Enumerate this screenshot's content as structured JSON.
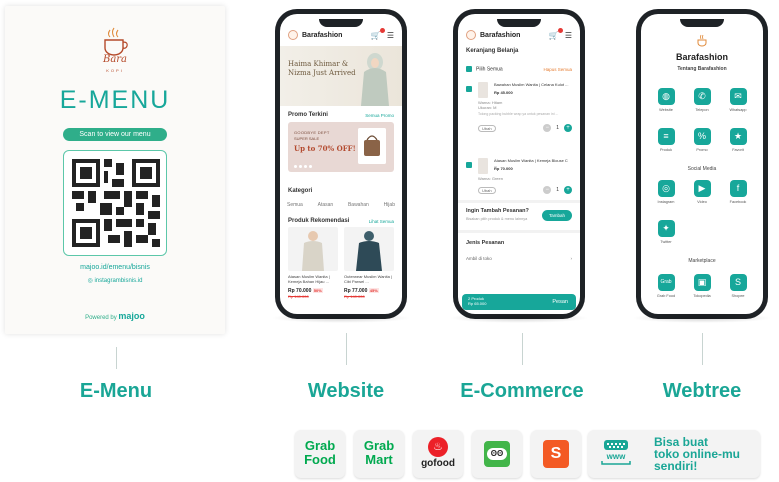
{
  "emenu_card": {
    "logo_text": "Bara",
    "logo_sub": "KOPI",
    "title": "E-MENU",
    "scan_label": "Scan to view our menu",
    "link": "majoo.id/emenu/bisnis",
    "instagram": "instagrambisnis.id",
    "powered_by": "Powered by",
    "powered_brand": "majoo"
  },
  "website_phone": {
    "brand": "Barafashion",
    "hero_text_1": "Haima Khimar &",
    "hero_text_2": "Nizma Just Arrived",
    "promo_title": "Promo Terkini",
    "promo_link": "Semua Promo",
    "promo_line1": "GOODBYE DEPT",
    "promo_line2": "SUPER SALE",
    "promo_big": "Up to 70% OFF!",
    "category_title": "Kategori",
    "categories": [
      "Semua",
      "Atasan",
      "Bawahan",
      "Hijab"
    ],
    "products_title": "Produk Rekomendasi",
    "products_link": "Lihat Semua",
    "products": [
      {
        "name": "Atasan Muslim Wanita | Kemeja Bahan Hijau ...",
        "price": "Rp 70.000",
        "discount": "50%",
        "old_price": "Rp 140.000"
      },
      {
        "name": "Outerwear Muslim Wanita | Cibi Parwel ...",
        "price": "Rp 77.000",
        "discount": "45%",
        "old_price": "Rp 140.000"
      }
    ]
  },
  "ecommerce_phone": {
    "brand": "Barafashion",
    "cart_title": "Keranjang Belanja",
    "select_all": "Pilih Semua",
    "remove_all": "Hapus Semua",
    "items": [
      {
        "name": "Bawahan Muslim Wanita | Celana Kulot ...",
        "price": "Rp 45.000",
        "variant": "Warna: Hitam",
        "variant2": "Ukuran: M",
        "note": "Tolong packing bubble wrap ya untuk pesanan ini ...",
        "edit": "Ubah",
        "qty": "1"
      },
      {
        "name": "Atasan Muslim Wanita | Kemeja Blouse C ...",
        "price": "Rp 70.000",
        "variant": "Warna: Green",
        "edit": "Ubah",
        "qty": "1"
      }
    ],
    "add_more_title": "Ingin Tambah Pesanan?",
    "add_more_sub": "Bisakan pilih produk & menu lainnya",
    "add_button": "Tambah",
    "order_type_title": "Jenis Pesanan",
    "order_type_value": "Ambil di toko",
    "checkout_count": "2 Produk",
    "checkout_total": "Rp 65.000",
    "checkout_button": "Pesan"
  },
  "webtree_phone": {
    "brand": "Barafashion",
    "about_title": "Tentang Barafashion",
    "row1": [
      {
        "icon": "globe-icon",
        "label": "Website"
      },
      {
        "icon": "phone-icon",
        "label": "Telepon"
      },
      {
        "icon": "whatsapp-icon",
        "label": "Whatsapp"
      }
    ],
    "row2": [
      {
        "icon": "list-icon",
        "label": "Produk"
      },
      {
        "icon": "percent-icon",
        "label": "Promo"
      },
      {
        "icon": "star-icon",
        "label": "Favorit"
      }
    ],
    "social_title": "Social Media",
    "row3": [
      {
        "icon": "instagram-icon",
        "label": "Instagram"
      },
      {
        "icon": "video-icon",
        "label": "Video"
      },
      {
        "icon": "facebook-icon",
        "label": "Facebook"
      }
    ],
    "row4": [
      {
        "icon": "twitter-icon",
        "label": "Twitter"
      }
    ],
    "marketplace_title": "Marketplace",
    "row5": [
      {
        "icon": "grab-icon",
        "label": "Grab Food"
      },
      {
        "icon": "tokopedia-icon",
        "label": "Tokopedia"
      },
      {
        "icon": "shopee-icon",
        "label": "Shopee"
      }
    ]
  },
  "labels": {
    "emenu": "E-Menu",
    "website": "Website",
    "ecommerce": "E-Commerce",
    "webtree": "Webtree"
  },
  "partners": {
    "grabfood_1": "Grab",
    "grabfood_2": "Food",
    "grabmart_1": "Grab",
    "grabmart_2": "Mart",
    "gofood": "gofood",
    "online_1": "Bisa buat",
    "online_2": "toko online-mu",
    "online_3": "sendiri!"
  },
  "colors": {
    "teal": "#17a79a",
    "label_teal": "#1aa696",
    "grab_green": "#00a94f",
    "gofood_red": "#ec2028",
    "tokopedia_green": "#42b549",
    "shopee_orange": "#f35a24"
  }
}
